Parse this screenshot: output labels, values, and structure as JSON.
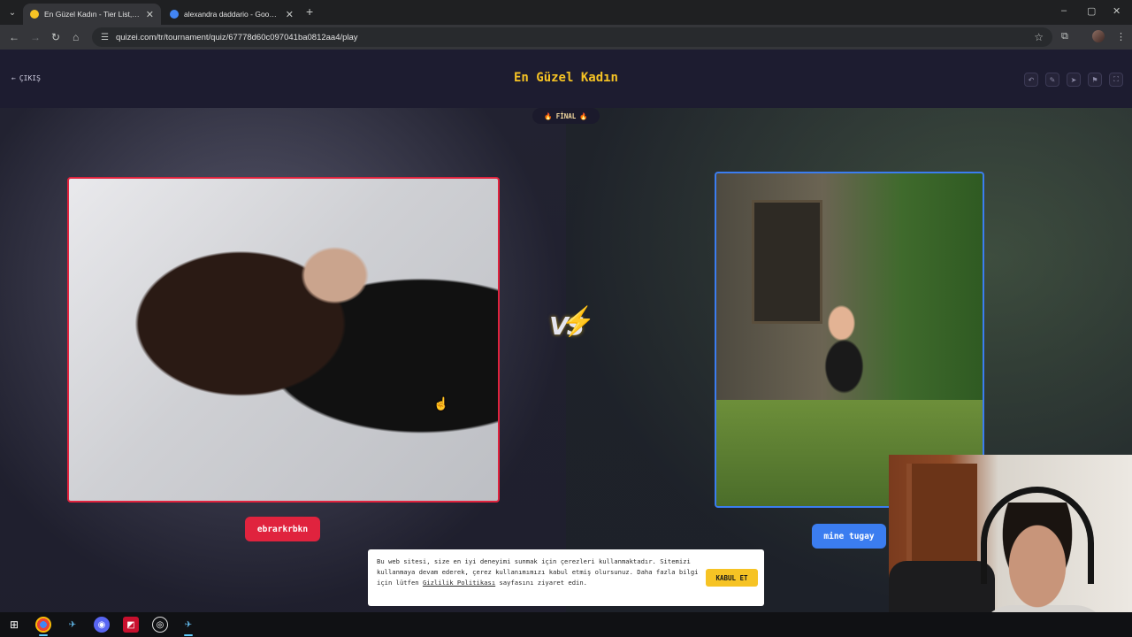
{
  "browser": {
    "tabs": [
      {
        "title": "En Güzel Kadın - Tier List, Kör S",
        "active": true,
        "favicon_color": "#f6c324"
      },
      {
        "title": "alexandra daddario - Google'da",
        "active": false,
        "favicon_color": "#4285f4"
      }
    ],
    "new_tab": "+",
    "url": "quizei.com/tr/tournament/quiz/67778d60c097041ba0812aa4/play",
    "window_controls": {
      "minimize": "–",
      "maximize": "▢",
      "close": "✕"
    }
  },
  "page": {
    "exit_label": "ÇIKIŞ",
    "title": "En Güzel Kadın",
    "round_badge": "FİNAL",
    "vs_label": "VS",
    "left_contestant": {
      "name": "ebrarkrbkn",
      "color": "#e0233e"
    },
    "right_contestant": {
      "name": "mine tugay",
      "color": "#3b7df0"
    },
    "header_icons": [
      "undo-icon",
      "edit-icon",
      "send-icon",
      "flag-icon",
      "fullscreen-icon"
    ]
  },
  "cookie_banner": {
    "text_before_link": "Bu web sitesi, size en iyi deneyimi sunmak için çerezleri kullanmaktadır. Sitemizi kullanmaya devam ederek, çerez kullanımımızı kabul etmiş olursunuz. Daha fazla bilgi için lütfen ",
    "link_text": "Gizlilik Politikası",
    "text_after_link": " sayfasını ziyaret edin.",
    "accept_label": "KABUL ET"
  },
  "taskbar": {
    "items": [
      "windows-start-icon",
      "chrome-icon",
      "steam-icon",
      "discord-icon",
      "amd-icon",
      "obs-icon",
      "steam-icon"
    ]
  }
}
